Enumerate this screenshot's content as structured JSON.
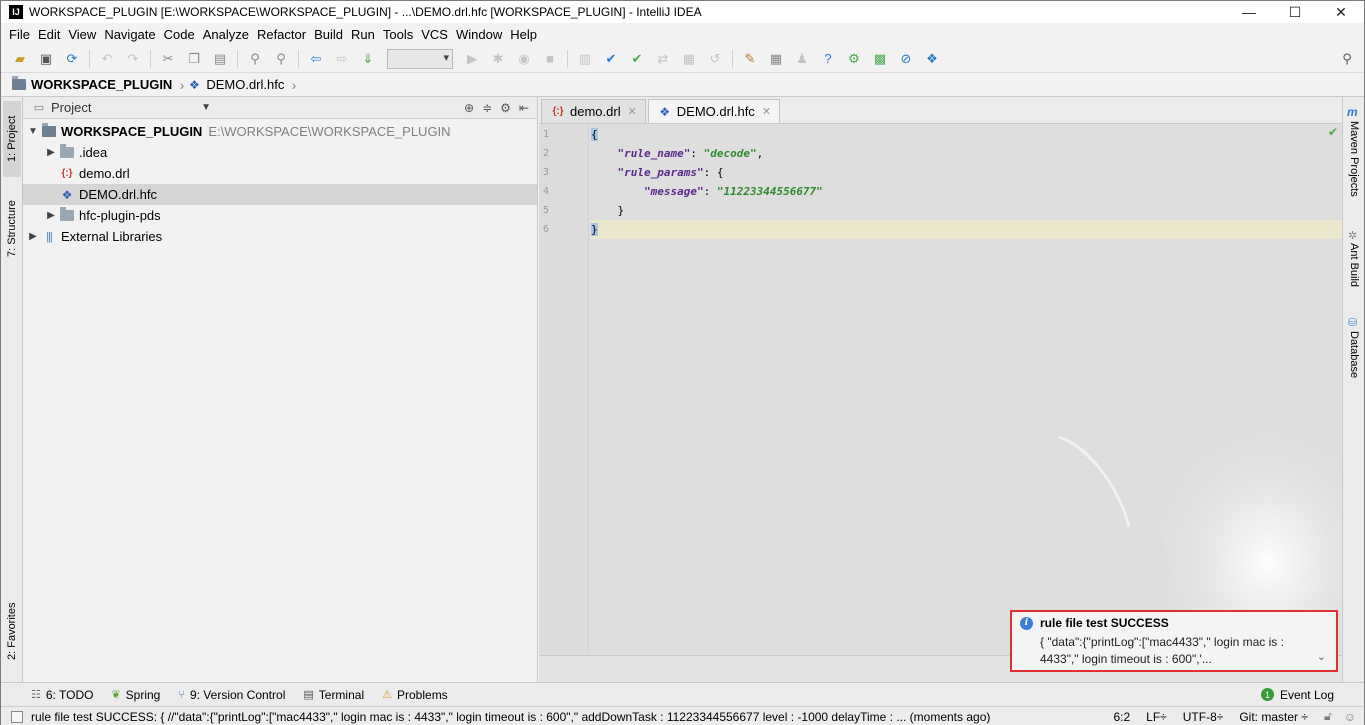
{
  "window": {
    "title": "WORKSPACE_PLUGIN [E:\\WORKSPACE\\WORKSPACE_PLUGIN] - ...\\DEMO.drl.hfc [WORKSPACE_PLUGIN] - IntelliJ IDEA",
    "app_icon": "IJ",
    "controls": [
      "—",
      "☐",
      "✕"
    ]
  },
  "menu": [
    "File",
    "Edit",
    "View",
    "Navigate",
    "Code",
    "Analyze",
    "Refactor",
    "Build",
    "Run",
    "Tools",
    "VCS",
    "Window",
    "Help"
  ],
  "toolbar": {
    "icons": [
      "open-folder-icon",
      "save-icon",
      "sync-icon",
      "undo-icon",
      "redo-icon",
      "cut-icon",
      "copy-icon",
      "paste-icon",
      "find-icon",
      "replace-icon",
      "back-icon",
      "forward-icon",
      "sort-icon",
      "run-config-combo",
      "run-icon",
      "debug-icon",
      "stop-icon",
      "vcs-icon"
    ],
    "search_icon": "search-icon"
  },
  "breadcrumb": [
    "WORKSPACE_PLUGIN",
    "DEMO.drl.hfc"
  ],
  "left_tabs": [
    "1: Project",
    "7: Structure",
    "2: Favorites"
  ],
  "right_tabs": [
    "Maven Projects",
    "Ant Build",
    "Database"
  ],
  "project": {
    "selector": "Project",
    "tree": [
      {
        "name": "WORKSPACE_PLUGIN",
        "path": "E:\\WORKSPACE\\WORKSPACE_PLUGIN",
        "level": 0,
        "type": "module",
        "expanded": true
      },
      {
        "name": ".idea",
        "level": 1,
        "type": "folder",
        "expanded": false
      },
      {
        "name": "demo.drl",
        "level": 1,
        "type": "drl"
      },
      {
        "name": "DEMO.drl.hfc",
        "level": 1,
        "type": "hfc",
        "selected": true
      },
      {
        "name": "hfc-plugin-pds",
        "level": 1,
        "type": "folder",
        "expanded": false
      },
      {
        "name": "External Libraries",
        "level": 0,
        "type": "library",
        "expanded": false
      }
    ]
  },
  "editor": {
    "tabs": [
      {
        "label": "demo.drl",
        "active": false
      },
      {
        "label": "DEMO.drl.hfc",
        "active": true
      }
    ],
    "line_numbers": [
      "1",
      "2",
      "3",
      "4",
      "5",
      "6"
    ],
    "lines": [
      {
        "indent": "",
        "key": "",
        "sep": "",
        "val": "",
        "raw": "{"
      },
      {
        "indent": "    ",
        "key": "\"rule_name\"",
        "sep": ": ",
        "val": "\"decode\"",
        "raw": ","
      },
      {
        "indent": "    ",
        "key": "\"rule_params\"",
        "sep": ": ",
        "val": "",
        "raw": "{"
      },
      {
        "indent": "        ",
        "key": "\"message\"",
        "sep": ": ",
        "val": "\"11223344556677\"",
        "raw": ""
      },
      {
        "indent": "    ",
        "key": "",
        "sep": "",
        "val": "",
        "raw": "}"
      },
      {
        "indent": "",
        "key": "",
        "sep": "",
        "val": "",
        "raw": "}"
      }
    ],
    "current_line": 6
  },
  "notification": {
    "title": "rule file test SUCCESS",
    "body": "{ \"data\":{\"printLog\":[\"mac4433\",\" login mac is : 4433\",\" login timeout is : 600\",'..."
  },
  "bottom_tabs": [
    {
      "label": "6: TODO",
      "icon": "todo-icon"
    },
    {
      "label": "Spring",
      "icon": "spring-icon"
    },
    {
      "label": "9: Version Control",
      "icon": "vcs-icon"
    },
    {
      "label": "Terminal",
      "icon": "terminal-icon"
    },
    {
      "label": "Problems",
      "icon": "warning-icon"
    }
  ],
  "event_log": {
    "label": "Event Log",
    "count": "1"
  },
  "status": {
    "message": "rule file test SUCCESS: { //\"data\":{\"printLog\":[\"mac4433\",\" login mac is : 4433\",\" login timeout is : 600\",\" addDownTask : 11223344556677 level : -1000 delayTime : ... (moments ago)",
    "position": "6:2",
    "line_sep": "LF÷",
    "encoding": "UTF-8÷",
    "git": "Git: master ÷"
  },
  "colors": {
    "editor_bg": "#dedede",
    "keyword": "#5b2a8c",
    "string": "#2e8b2e",
    "current_line": "#ebe8cd",
    "notification_border": "#e03030"
  }
}
